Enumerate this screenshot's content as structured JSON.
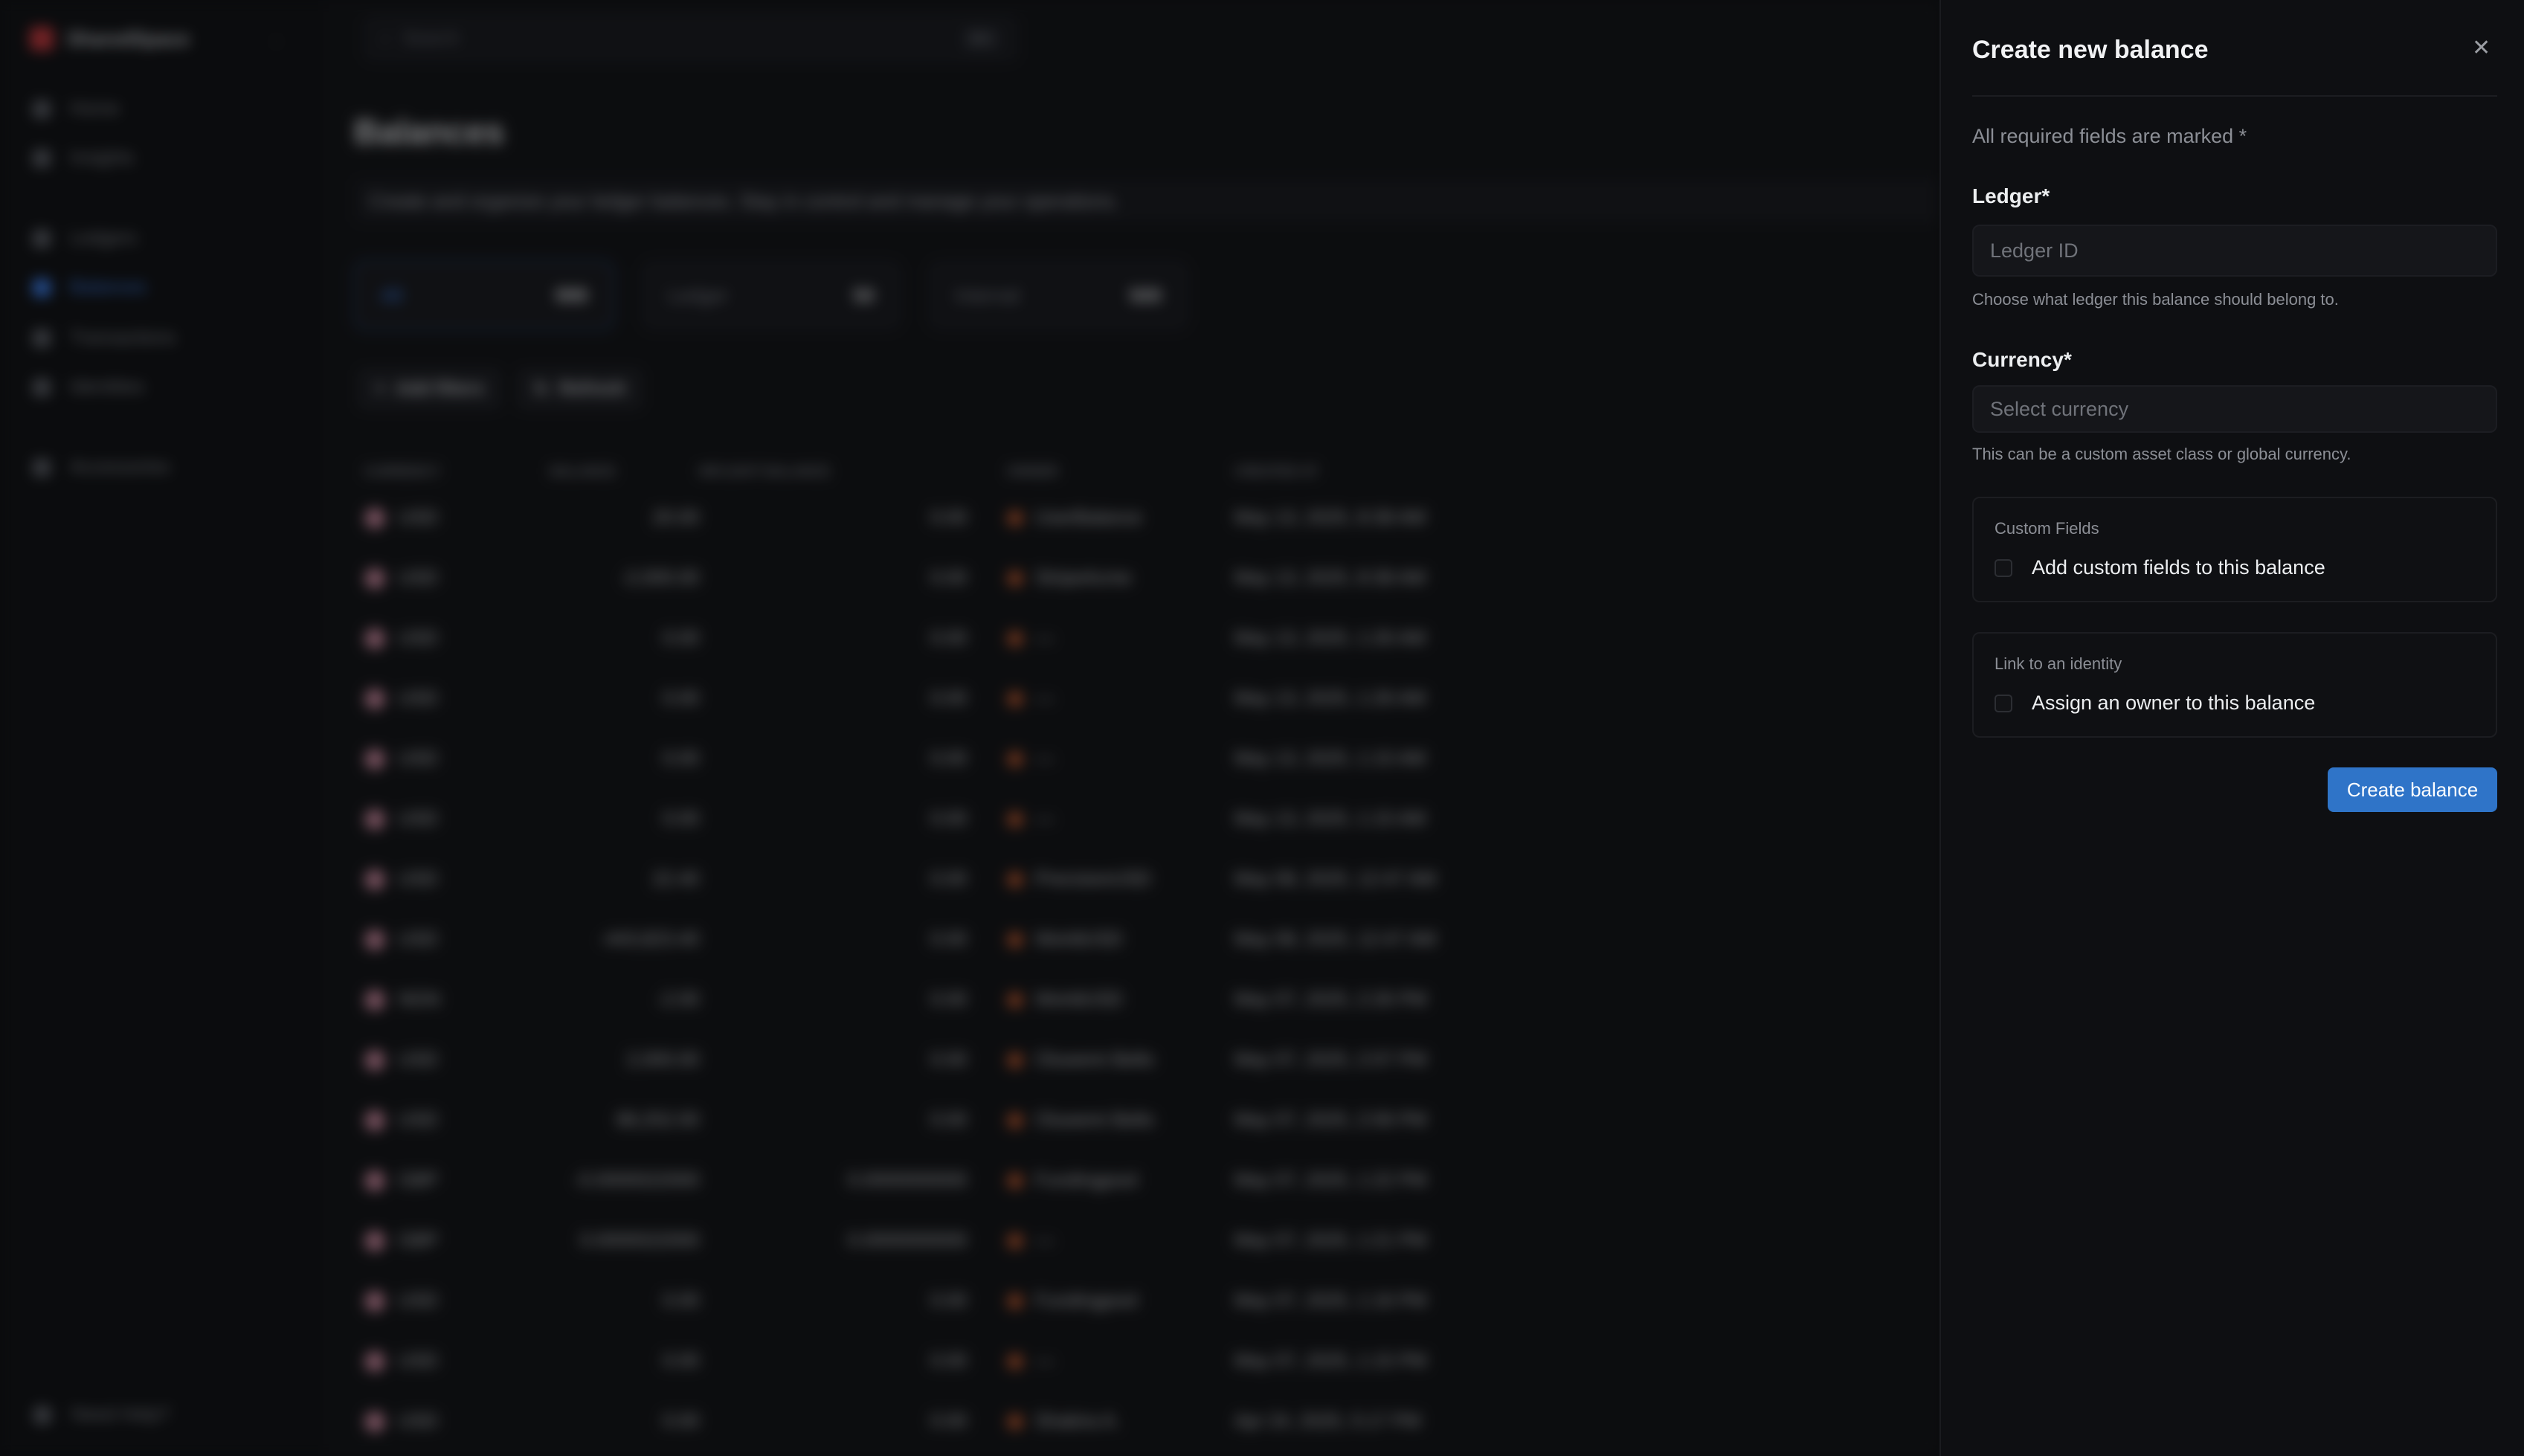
{
  "background_app": {
    "workspace": "SharedSpace",
    "nav": [
      "Home",
      "Insights",
      "Ledgers",
      "Balances",
      "Transactions",
      "Identities",
      "Accessories"
    ],
    "active_nav": "Balances",
    "search_placeholder": "Search",
    "search_shortcut": "⌘K",
    "page_title": "Balances",
    "page_subtitle": "Create and organize your ledger balances. Stay in control and manage your operations.",
    "stats": [
      {
        "label": "All",
        "value": "999"
      },
      {
        "label": "Ledger",
        "value": "50"
      },
      {
        "label": "Internal",
        "value": "500"
      }
    ],
    "buttons": {
      "filters": "Add filters",
      "refresh": "Refresh"
    },
    "help": "Need Help?",
    "table": {
      "headers": [
        "CURRENCY",
        "BALANCE",
        "INFLIGHT BALANCE",
        "OWNER",
        "CREATED AT"
      ],
      "rows": [
        [
          "USD",
          "20.00",
          "0.00",
          "UserBalance",
          "May 13, 2025, 8:38 AM"
        ],
        [
          "USD",
          "-2,000.00",
          "0.00",
          "StripeAcme",
          "May 13, 2025, 8:38 AM"
        ],
        [
          "USD",
          "0.00",
          "0.00",
          "—",
          "May 13, 2025, 1:26 AM"
        ],
        [
          "USD",
          "0.00",
          "0.00",
          "—",
          "May 13, 2025, 1:26 AM"
        ],
        [
          "USD",
          "0.00",
          "0.00",
          "—",
          "May 13, 2025, 1:15 AM"
        ],
        [
          "USD",
          "0.00",
          "0.00",
          "—",
          "May 13, 2025, 1:15 AM"
        ],
        [
          "USD",
          "22.40",
          "0.00",
          "PrecisionUSD",
          "May 08, 2025, 12:47 AM"
        ],
        [
          "USD",
          "-443,823.40",
          "0.00",
          "WorldUSD",
          "May 08, 2025, 12:47 AM"
        ],
        [
          "NGN",
          "-2.00",
          "0.00",
          "WorldUSD",
          "May 07, 2025, 2:26 PM"
        ],
        [
          "USD",
          "2,000.00",
          "0.00",
          "Oluwemi Bello",
          "May 07, 2025, 2:07 PM"
        ],
        [
          "USD",
          "88,252.00",
          "0.00",
          "Oluwemi Bello",
          "May 07, 2025, 2:06 PM"
        ],
        [
          "GBP",
          "-0.0000022000",
          "0.0000000000",
          "Fundingpool",
          "May 07, 2025, 1:22 PM"
        ],
        [
          "GBP",
          "0.0000022000",
          "0.0000000000",
          "—",
          "May 07, 2025, 1:21 PM"
        ],
        [
          "USD",
          "0.00",
          "0.00",
          "Fundingpool",
          "May 07, 2025, 1:16 PM"
        ],
        [
          "USD",
          "0.00",
          "0.00",
          "—",
          "May 07, 2025, 1:15 PM"
        ],
        [
          "USD",
          "0.00",
          "0.00",
          "Shakira A.",
          "Apr 24, 2025, 5:17 PM"
        ]
      ]
    }
  },
  "drawer": {
    "title": "Create new balance",
    "close_icon": "close-icon",
    "required_note": "All required fields are marked *",
    "ledger": {
      "label": "Ledger*",
      "placeholder": "Ledger ID",
      "value": "",
      "hint": "Choose what ledger this balance should belong to."
    },
    "currency": {
      "label": "Currency*",
      "placeholder": "Select currency",
      "value": "",
      "hint": "This can be a custom asset class or global currency."
    },
    "custom_fields": {
      "caption": "Custom Fields",
      "checkbox_label": "Add custom fields to this balance",
      "checked": false
    },
    "identity": {
      "caption": "Link to an identity",
      "checkbox_label": "Assign an owner to this balance",
      "checked": false
    },
    "submit_label": "Create balance",
    "colors": {
      "primary": "#2f74c8",
      "background": "#0e0f12"
    }
  }
}
